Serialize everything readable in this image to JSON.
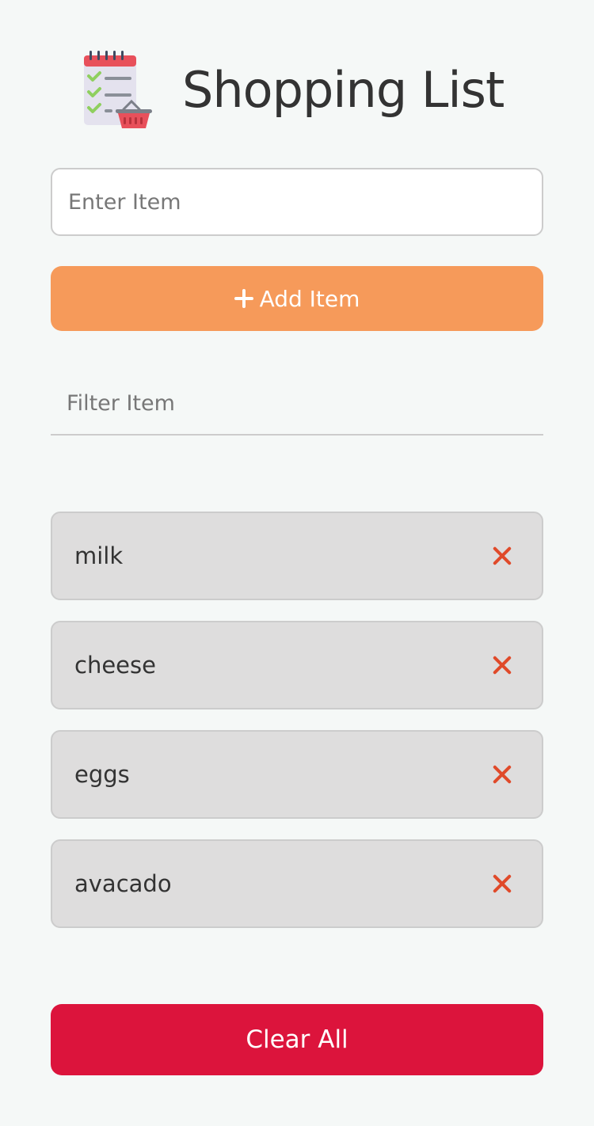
{
  "header": {
    "title": "Shopping List",
    "icon": "shopping-list-icon"
  },
  "form": {
    "item_placeholder": "Enter Item",
    "item_value": "",
    "add_label": "Add Item",
    "add_icon": "plus-icon"
  },
  "filter": {
    "placeholder": "Filter Item",
    "value": ""
  },
  "items": [
    {
      "label": "milk",
      "remove_icon": "close-icon"
    },
    {
      "label": "cheese",
      "remove_icon": "close-icon"
    },
    {
      "label": "eggs",
      "remove_icon": "close-icon"
    },
    {
      "label": "avacado",
      "remove_icon": "close-icon"
    }
  ],
  "clear_label": "Clear All",
  "colors": {
    "background": "#f5f8f7",
    "add_button": "#f69a5a",
    "clear_button": "#dc143c",
    "remove_icon": "#e04a2a",
    "item_background": "#dedddd"
  }
}
